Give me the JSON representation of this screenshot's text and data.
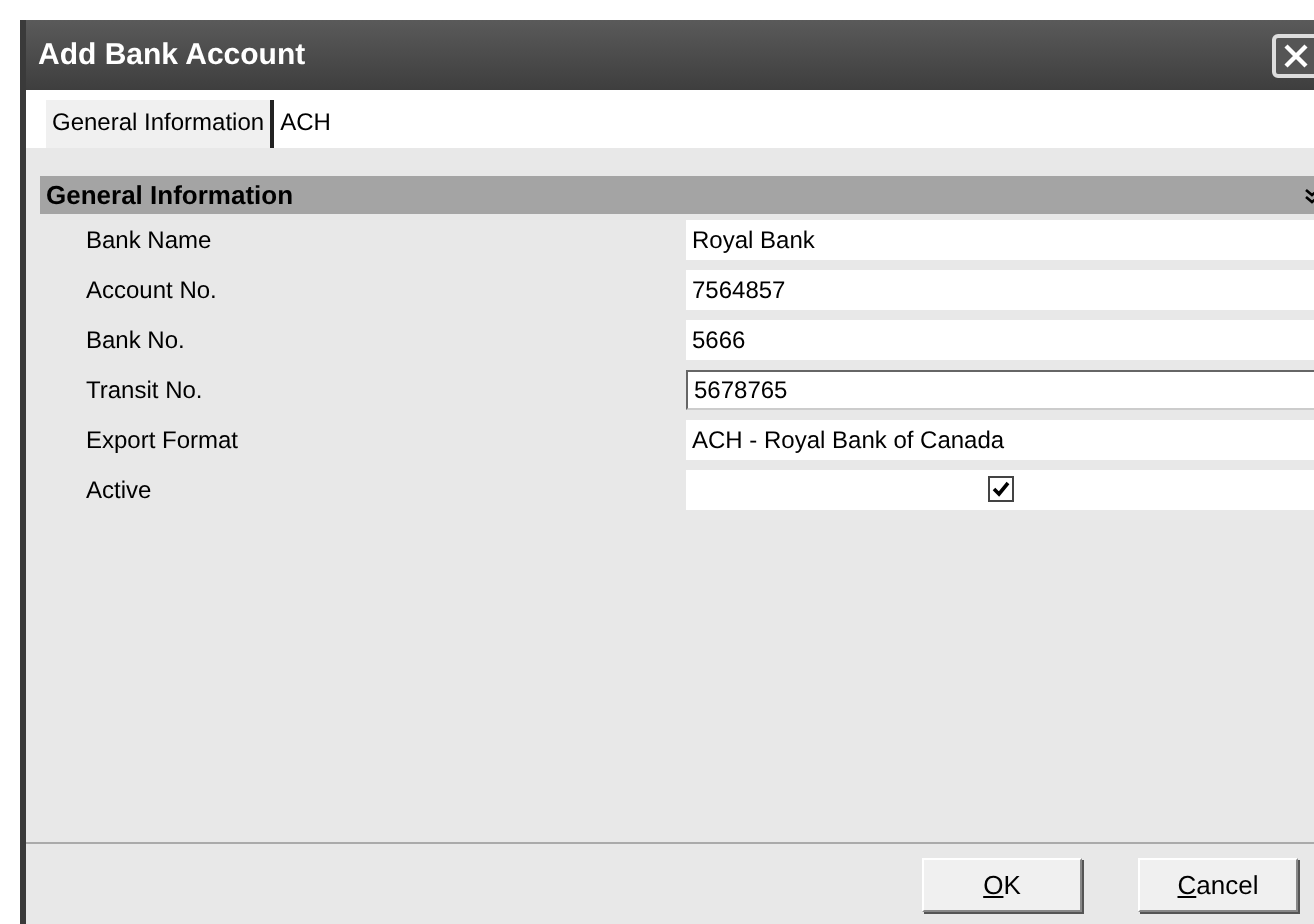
{
  "window": {
    "title": "Add Bank Account"
  },
  "tabs": [
    {
      "label": "General Information",
      "selected": true
    },
    {
      "label": "ACH",
      "selected": false
    }
  ],
  "section": {
    "title": "General Information",
    "expanded": true
  },
  "fields": [
    {
      "kind": "text",
      "label": "Bank Name",
      "value": "Royal Bank",
      "focused": false
    },
    {
      "kind": "text",
      "label": "Account No.",
      "value": "7564857",
      "focused": false
    },
    {
      "kind": "text",
      "label": "Bank No.",
      "value": "5666",
      "focused": false
    },
    {
      "kind": "text",
      "label": "Transit No.",
      "value": "5678765",
      "focused": true
    },
    {
      "kind": "text",
      "label": "Export Format",
      "value": "ACH - Royal Bank of Canada",
      "focused": false
    },
    {
      "kind": "checkbox",
      "label": "Active",
      "checked": true
    }
  ],
  "buttons": [
    {
      "label": "OK"
    },
    {
      "label": "Cancel"
    }
  ]
}
